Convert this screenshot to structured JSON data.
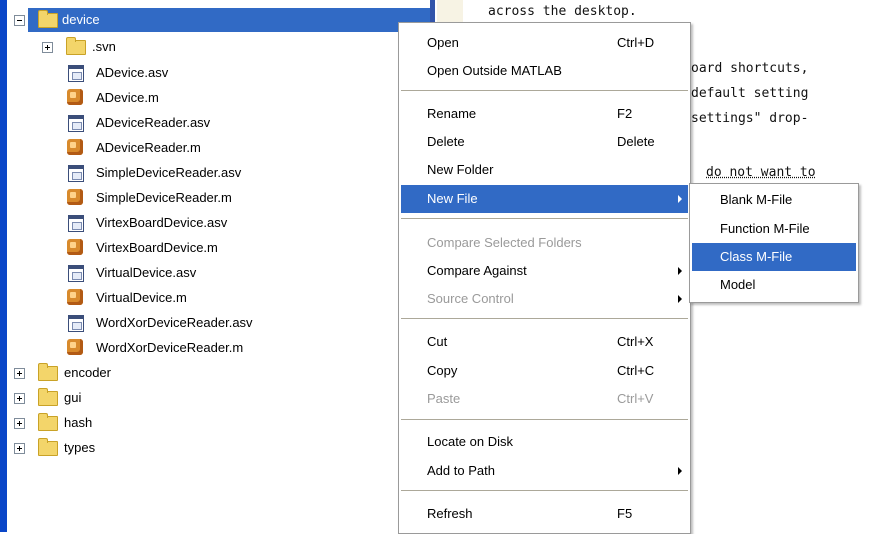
{
  "tree": {
    "root": {
      "label": "device",
      "expanded": true
    },
    "children": [
      {
        "label": ".svn",
        "type": "folder",
        "expander": "plus"
      },
      {
        "label": "ADevice.asv",
        "type": "asv"
      },
      {
        "label": "ADevice.m",
        "type": "m"
      },
      {
        "label": "ADeviceReader.asv",
        "type": "asv"
      },
      {
        "label": "ADeviceReader.m",
        "type": "m"
      },
      {
        "label": "SimpleDeviceReader.asv",
        "type": "asv"
      },
      {
        "label": "SimpleDeviceReader.m",
        "type": "m"
      },
      {
        "label": "VirtexBoardDevice.asv",
        "type": "asv"
      },
      {
        "label": "VirtexBoardDevice.m",
        "type": "m"
      },
      {
        "label": "VirtualDevice.asv",
        "type": "asv"
      },
      {
        "label": "VirtualDevice.m",
        "type": "m"
      },
      {
        "label": "WordXorDeviceReader.asv",
        "type": "asv"
      },
      {
        "label": "WordXorDeviceReader.m",
        "type": "m"
      }
    ],
    "siblings": [
      {
        "label": "encoder"
      },
      {
        "label": "gui"
      },
      {
        "label": "hash"
      },
      {
        "label": "types"
      }
    ]
  },
  "editor": {
    "lines": [
      "across the desktop.",
      "oard shortcuts,",
      "default setting",
      "settings\" drop-",
      "do not want to"
    ]
  },
  "context_menu": {
    "items": [
      {
        "label": "Open",
        "shortcut": "Ctrl+D"
      },
      {
        "label": "Open Outside MATLAB",
        "shortcut": ""
      },
      {
        "label": "Rename",
        "shortcut": "F2"
      },
      {
        "label": "Delete",
        "shortcut": "Delete"
      },
      {
        "label": "New Folder",
        "shortcut": ""
      },
      {
        "label": "New File",
        "shortcut": "",
        "submenu": true,
        "selected": true
      },
      {
        "label": "Compare Selected Folders",
        "shortcut": "",
        "disabled": true
      },
      {
        "label": "Compare Against",
        "shortcut": "",
        "submenu": true
      },
      {
        "label": "Source Control",
        "shortcut": "",
        "submenu": true,
        "disabled": true
      },
      {
        "label": "Cut",
        "shortcut": "Ctrl+X"
      },
      {
        "label": "Copy",
        "shortcut": "Ctrl+C"
      },
      {
        "label": "Paste",
        "shortcut": "Ctrl+V",
        "disabled": true
      },
      {
        "label": "Locate on Disk",
        "shortcut": ""
      },
      {
        "label": "Add to Path",
        "shortcut": "",
        "submenu": true
      },
      {
        "label": "Refresh",
        "shortcut": "F5"
      }
    ]
  },
  "submenu": {
    "items": [
      {
        "label": "Blank M-File"
      },
      {
        "label": "Function M-File"
      },
      {
        "label": "Class M-File",
        "selected": true
      },
      {
        "label": "Model"
      }
    ]
  },
  "colors": {
    "selection": "#316ac5",
    "disabled_text": "#9a9a9a",
    "menu_bg": "#ffffff"
  }
}
